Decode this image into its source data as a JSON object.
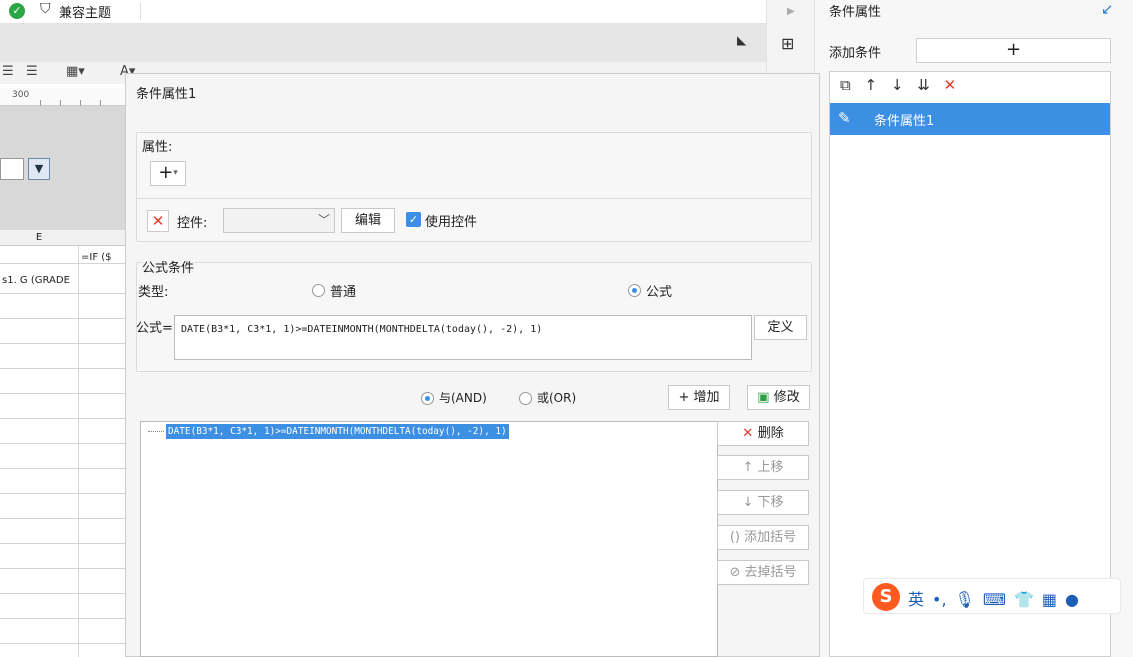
{
  "header": {
    "title": "兼容主题"
  },
  "ruler": {
    "label": "300"
  },
  "sheet": {
    "column_label": "E",
    "cells": [
      "s1. G (GRADE",
      "=IF ($"
    ]
  },
  "right_panel": {
    "title": "条件属性",
    "add_label": "添加条件",
    "add_button": "+",
    "toolbar_icons": [
      "copy-icon",
      "arrow-up-icon",
      "arrow-down-icon",
      "sort-icon",
      "delete-icon"
    ],
    "items": [
      {
        "label": "条件属性1",
        "selected": true
      }
    ]
  },
  "dialog": {
    "title": "条件属性1",
    "attr_section": {
      "label": "属性:",
      "add_button": "+",
      "control_label": "控件:",
      "control_value": "",
      "edit_button": "编辑",
      "use_control_label": "使用控件",
      "use_control_checked": true
    },
    "formula_section": {
      "legend": "公式条件",
      "type_label": "类型:",
      "type_options": [
        "普通",
        "公式"
      ],
      "type_selected": "公式",
      "formula_label": "公式=",
      "formula_value": "DATE(B3*1, C3*1, 1)>=DATEINMONTH(MONTHDELTA(today(), -2), 1)",
      "define_button": "定义",
      "logic_options": [
        "与(AND)",
        "或(OR)"
      ],
      "logic_selected": "与(AND)",
      "add_button": "增加",
      "modify_button": "修改",
      "delete_button": "删除",
      "move_up_button": "上移",
      "move_down_button": "下移",
      "add_bracket_button": "添加括号",
      "remove_bracket_button": "去掉括号",
      "conditions": [
        "DATE(B3*1, C3*1, 1)>=DATEINMONTH(MONTHDELTA(today(), -2), 1)"
      ]
    }
  },
  "ime": {
    "logo": "S",
    "mode": "英"
  },
  "colors": {
    "accent": "#3d8fe3",
    "danger": "#e53b2c",
    "ok": "#29a745"
  }
}
